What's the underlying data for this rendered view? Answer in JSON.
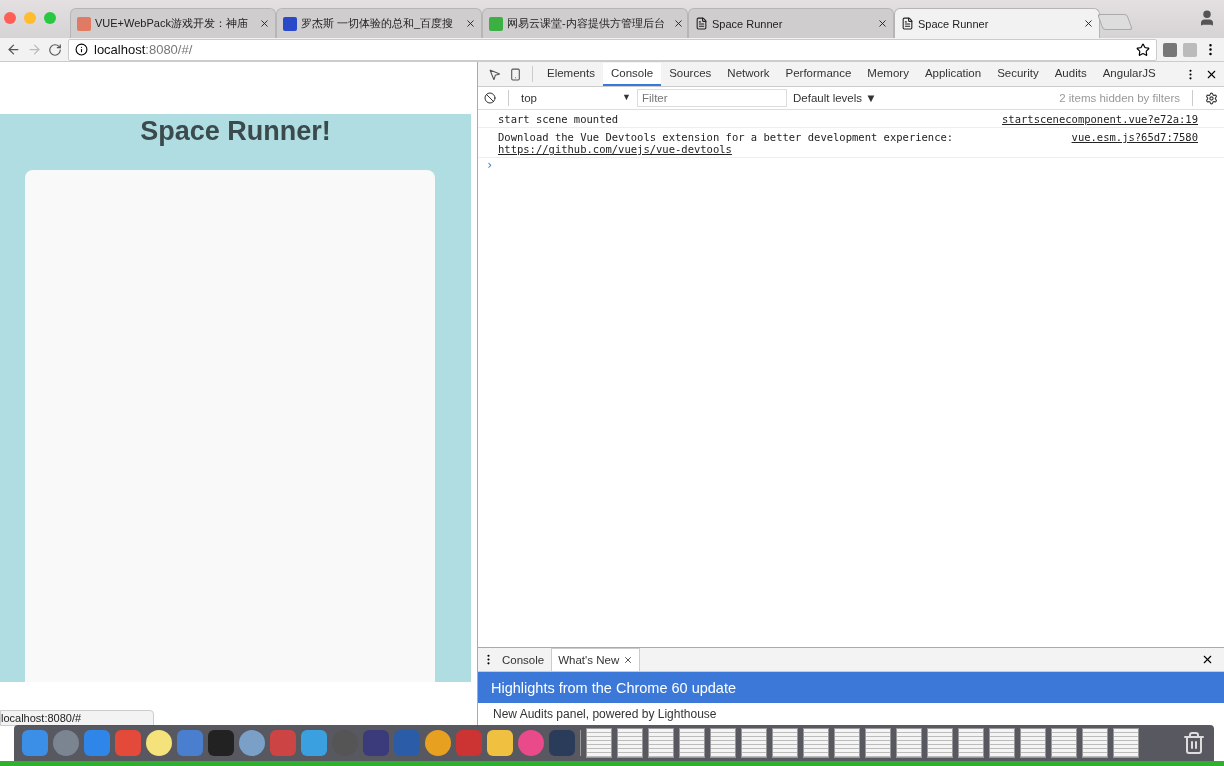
{
  "browser": {
    "tabs": [
      {
        "title": "VUE+WebPack游戏开发：神庙",
        "selected": false
      },
      {
        "title": "罗杰斯 一切体验的总和_百度搜",
        "selected": false
      },
      {
        "title": "网易云课堂-内容提供方管理后台",
        "selected": false
      },
      {
        "title": "Space Runner",
        "selected": false
      },
      {
        "title": "Space Runner",
        "selected": true
      }
    ],
    "address": {
      "host": "localhost",
      "rest": ":8080/#/"
    },
    "status_url": "localhost:8080/#"
  },
  "page": {
    "title": "Space Runner!"
  },
  "devtools": {
    "tabs": [
      {
        "label": "Elements",
        "selected": false
      },
      {
        "label": "Console",
        "selected": true
      },
      {
        "label": "Sources",
        "selected": false
      },
      {
        "label": "Network",
        "selected": false
      },
      {
        "label": "Performance",
        "selected": false
      },
      {
        "label": "Memory",
        "selected": false
      },
      {
        "label": "Application",
        "selected": false
      },
      {
        "label": "Security",
        "selected": false
      },
      {
        "label": "Audits",
        "selected": false
      },
      {
        "label": "AngularJS",
        "selected": false
      }
    ],
    "context": "top",
    "context_caret": "▼",
    "filter_placeholder": "Filter",
    "levels": "Default levels ▼",
    "hidden_note": "2 items hidden by filters",
    "messages": [
      {
        "text": "start scene mounted",
        "source": "startscenecomponent.vue?e72a:19"
      },
      {
        "text": "Download the Vue Devtools extension for a better development experience:",
        "link": "https://github.com/vuejs/vue-devtools",
        "source": "vue.esm.js?65d7:7580"
      }
    ],
    "prompt": "›",
    "drawer": {
      "tabs": [
        {
          "label": "Console",
          "selected": false
        },
        {
          "label": "What's New",
          "selected": true
        }
      ],
      "banner": "Highlights from the Chrome 60 update",
      "item": "New Audits panel, powered by Lighthouse"
    }
  }
}
